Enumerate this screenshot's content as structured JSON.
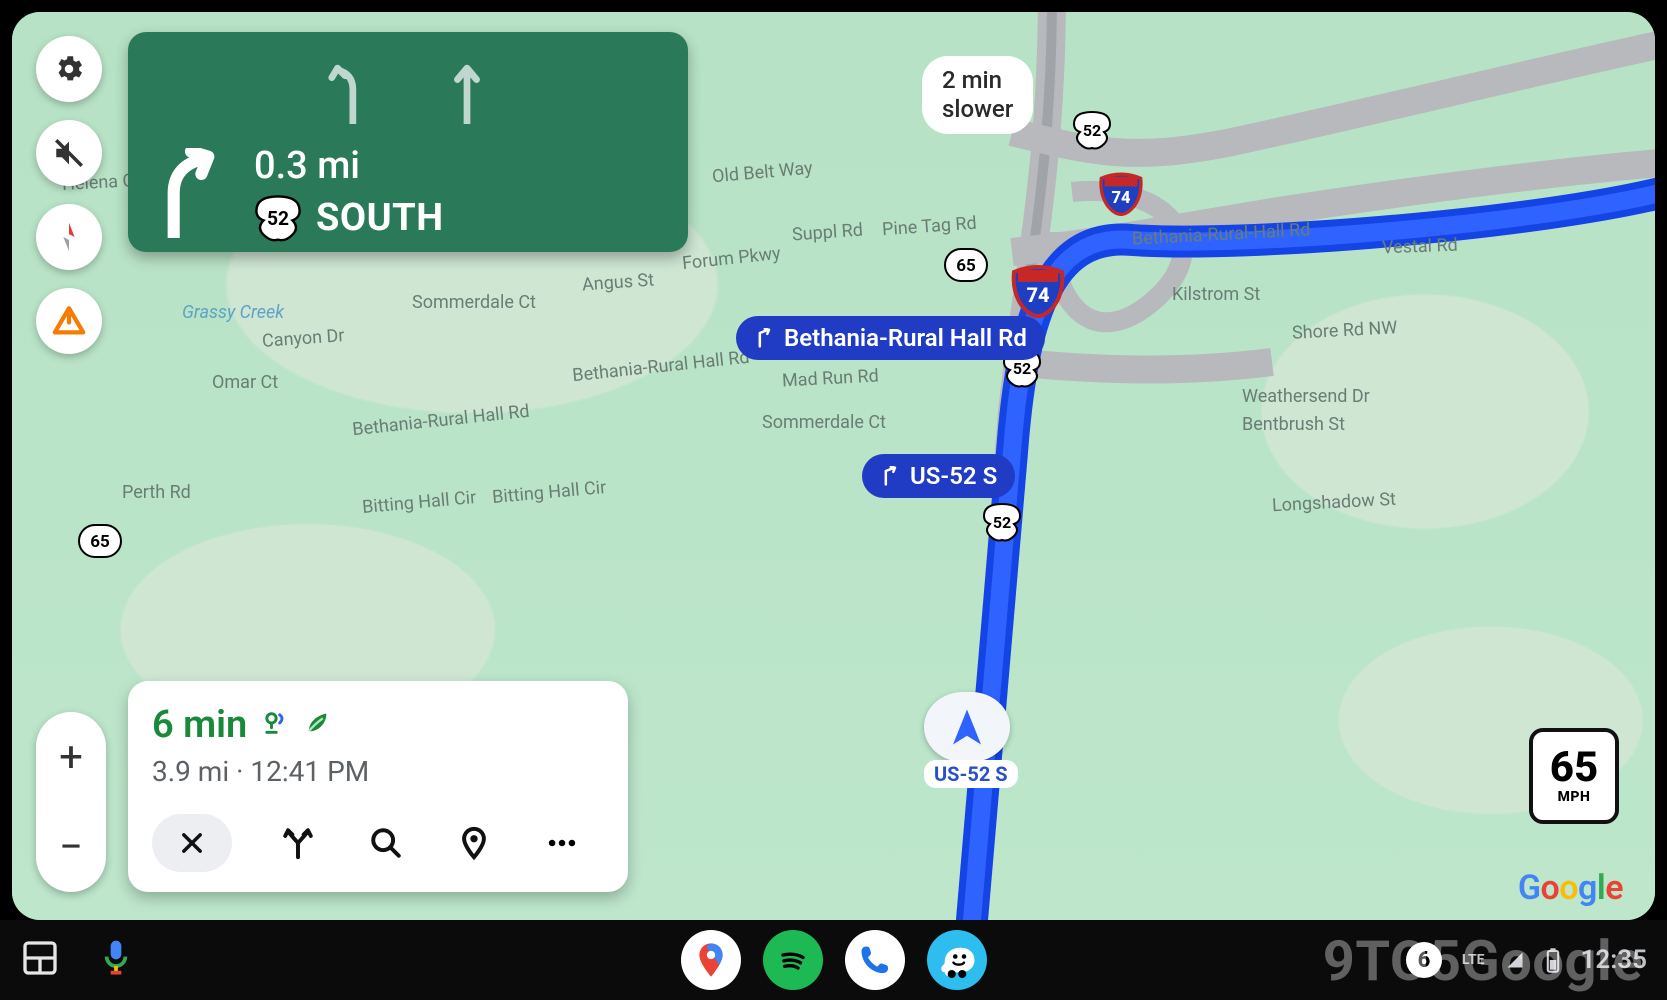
{
  "turn_card": {
    "distance": "0.3 mi",
    "route_number": "52",
    "direction": "SOUTH"
  },
  "trip": {
    "eta_duration": "6 min",
    "distance": "3.9 mi",
    "arrival_time": "12:41 PM"
  },
  "alt_route_label": "2 min\nslower",
  "map_pills": {
    "exit1": "Bethania-Rural Hall Rd",
    "exit2": "US-52 S"
  },
  "current_road": "US-52 S",
  "shields": {
    "us52_a": "52",
    "us52_b": "52",
    "us52_c": "52",
    "state65_a": "65",
    "state65_b": "65",
    "interstate74_a": "74",
    "interstate74_b": "74"
  },
  "road_labels": {
    "helena": "Helena Ct",
    "grassy": "Grassy Creek",
    "canyon": "Canyon Dr",
    "omar": "Omar Ct",
    "sommerdale1": "Sommerdale Ct",
    "sommerdale2": "Sommerdale Ct",
    "beth1": "Bethania-Rural Hall Rd",
    "beth2": "Bethania-Rural Hall Rd",
    "beth3": "Bethania-Rural-Hall Rd",
    "perth": "Perth Rd",
    "bitting1": "Bitting Hall Cir",
    "bitting2": "Bitting Hall Cir",
    "angus": "Angus St",
    "forum": "Forum Pkwy",
    "suppl": "Suppl Rd",
    "pinetag": "Pine Tag Rd",
    "oldbelt": "Old Belt Way",
    "madrun": "Mad Run Rd",
    "kilstrom": "Kilstrom St",
    "shore": "Shore Rd NW",
    "weathers": "Weathersend Dr",
    "bentbrush": "Bentbrush St",
    "longshadow": "Longshadow St",
    "vestal": "Vestal Rd"
  },
  "speed_limit": {
    "value": "65",
    "unit": "MPH"
  },
  "status_bar": {
    "notification_count": "6",
    "network": "LTE",
    "time": "12:35"
  },
  "watermark_brand": "9TO5Google"
}
